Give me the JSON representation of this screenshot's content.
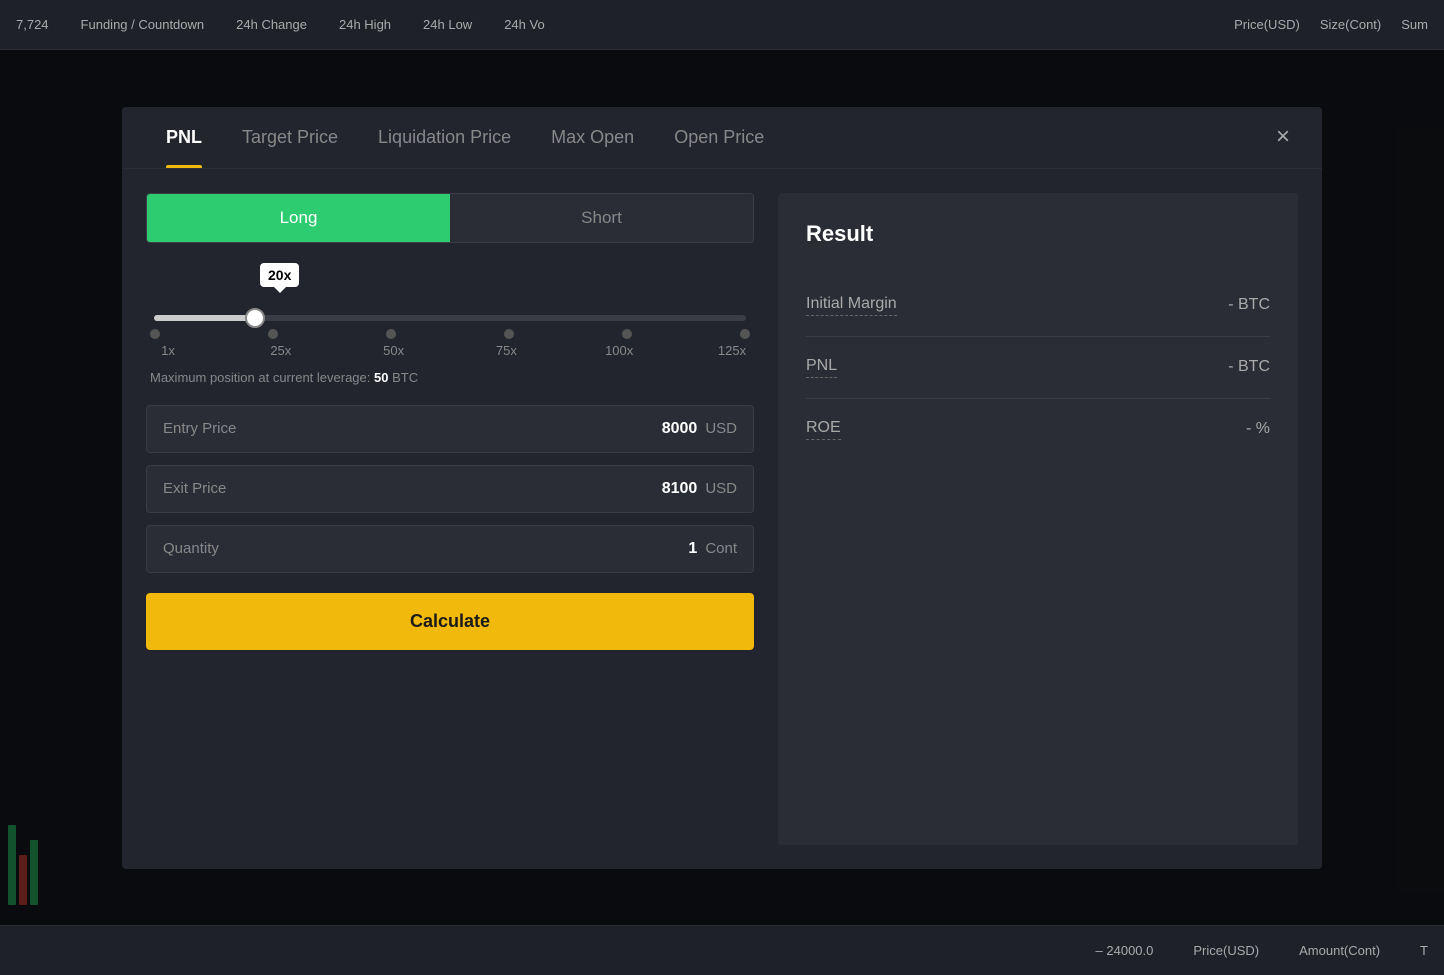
{
  "topbar": {
    "items": [
      {
        "label": "Funding / Countdown"
      },
      {
        "label": "24h Change"
      },
      {
        "label": "24h High"
      },
      {
        "label": "24h Low"
      },
      {
        "label": "24h Vo"
      }
    ],
    "right_items": [
      {
        "label": "Price(USD)"
      },
      {
        "label": "Size(Cont)"
      },
      {
        "label": "Sum"
      }
    ],
    "ticker": "7,724"
  },
  "bottombar": {
    "items": [
      {
        "label": "– 24000.0"
      },
      {
        "label": "Price(USD)"
      },
      {
        "label": "Amount(Cont)"
      },
      {
        "label": "T"
      }
    ]
  },
  "modal": {
    "tabs": [
      {
        "label": "PNL",
        "active": true
      },
      {
        "label": "Target Price",
        "active": false
      },
      {
        "label": "Liquidation Price",
        "active": false
      },
      {
        "label": "Max Open",
        "active": false
      },
      {
        "label": "Open Price",
        "active": false
      }
    ],
    "close_label": "×",
    "toggle": {
      "long_label": "Long",
      "short_label": "Short",
      "active": "long"
    },
    "leverage": {
      "bubble_label": "20x",
      "marks": [
        "1x",
        "25x",
        "50x",
        "75x",
        "100x",
        "125x"
      ],
      "max_position_text": "Maximum position at current leverage:",
      "max_position_value": "50",
      "max_position_unit": "BTC"
    },
    "inputs": [
      {
        "label": "Entry Price",
        "value": "8000",
        "unit": "USD"
      },
      {
        "label": "Exit Price",
        "value": "8100",
        "unit": "USD"
      },
      {
        "label": "Quantity",
        "value": "1",
        "unit": "Cont"
      }
    ],
    "calculate_label": "Calculate",
    "result": {
      "title": "Result",
      "rows": [
        {
          "label": "Initial Margin",
          "value": "- BTC"
        },
        {
          "label": "PNL",
          "value": "- BTC"
        },
        {
          "label": "ROE",
          "value": "- %"
        }
      ]
    }
  }
}
